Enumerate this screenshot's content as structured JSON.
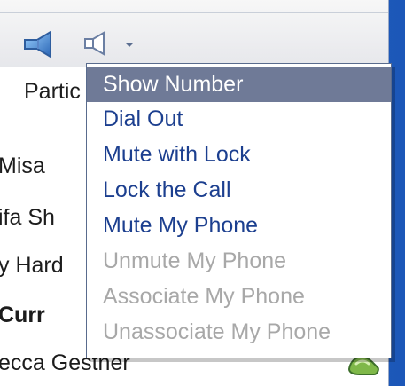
{
  "toolbar": {
    "speaker_icon": "speaker-icon",
    "mute_icon": "speaker-outline-icon",
    "caret_icon": "chevron-down-icon"
  },
  "header": {
    "column_label": "Partic"
  },
  "participants": [
    {
      "name": "Misa",
      "bold": false
    },
    {
      "name": "ifa Sh",
      "bold": false
    },
    {
      "name": "y Hard",
      "bold": false
    },
    {
      "name": "Curr",
      "bold": true
    },
    {
      "name": "ecca Gestner",
      "bold": false
    }
  ],
  "menu": {
    "items": [
      {
        "label": "Show Number",
        "state": "selected"
      },
      {
        "label": "Dial Out",
        "state": "enabled"
      },
      {
        "label": "Mute with Lock",
        "state": "enabled"
      },
      {
        "label": "Lock the Call",
        "state": "enabled"
      },
      {
        "label": "Mute My Phone",
        "state": "enabled"
      },
      {
        "label": "Unmute My Phone",
        "state": "disabled"
      },
      {
        "label": "Associate My Phone",
        "state": "disabled"
      },
      {
        "label": "Unassociate My Phone",
        "state": "disabled"
      }
    ]
  },
  "colors": {
    "accent_blue": "#1c3f8f",
    "disabled_gray": "#a8a8a8",
    "selected_background": "#6f7a97",
    "desktop_blue": "#1f56b7"
  },
  "status_icon": "green-phone-icon"
}
